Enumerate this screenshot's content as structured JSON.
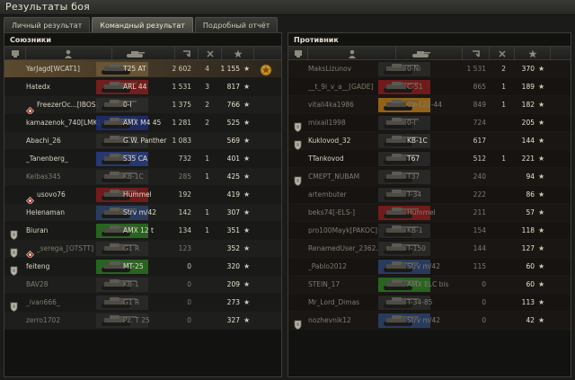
{
  "window": {
    "title": "Результаты боя"
  },
  "tabs": [
    {
      "label": "Личный результат",
      "active": false
    },
    {
      "label": "Командный результат",
      "active": true
    },
    {
      "label": "Подробный отчёт",
      "active": false
    }
  ],
  "allies": {
    "title": "Союзники",
    "rows": [
      {
        "name": "YarJagd[WCAT1]",
        "tank": "T25 AT",
        "dmg": "2 602",
        "kills": "4",
        "xp": "1 155",
        "dead": false,
        "highlight": true,
        "badge": false,
        "mark": false,
        "medal": true,
        "tankColor": "#6b5637"
      },
      {
        "name": "Hatedx",
        "tank": "ARL 44",
        "dmg": "1 531",
        "kills": "3",
        "xp": "817",
        "dead": false,
        "highlight": false,
        "badge": false,
        "mark": false,
        "medal": false,
        "tankColor": "#7b1f1f"
      },
      {
        "name": "FreezerOc...[IBOS]",
        "tank": "0-I",
        "dmg": "1 375",
        "kills": "2",
        "xp": "766",
        "dead": false,
        "highlight": false,
        "badge": false,
        "mark": true,
        "medal": false,
        "tankColor": "#2c2c2c"
      },
      {
        "name": "kamazenok_740[LMK]",
        "tank": "AMX M4 45",
        "dmg": "1 281",
        "kills": "2",
        "xp": "525",
        "dead": false,
        "highlight": false,
        "badge": false,
        "mark": false,
        "medal": false,
        "tankColor": "#1f2d6b"
      },
      {
        "name": "Abachi_26",
        "tank": "G.W. Panther",
        "dmg": "1 083",
        "kills": "",
        "xp": "569",
        "dead": false,
        "highlight": false,
        "badge": false,
        "mark": false,
        "medal": false,
        "tankColor": "#2a2a2a"
      },
      {
        "name": "_Tanenberg_",
        "tank": "S35 CA",
        "dmg": "732",
        "kills": "1",
        "xp": "401",
        "dead": false,
        "highlight": false,
        "badge": false,
        "mark": false,
        "medal": false,
        "tankColor": "#2a3c7a"
      },
      {
        "name": "Kelbas345",
        "tank": "KB-1C",
        "dmg": "285",
        "kills": "1",
        "xp": "425",
        "dead": true,
        "highlight": false,
        "badge": false,
        "mark": false,
        "medal": false,
        "tankColor": "#2a2a2a"
      },
      {
        "name": "usovo76",
        "tank": "Hummel",
        "dmg": "192",
        "kills": "",
        "xp": "419",
        "dead": false,
        "highlight": false,
        "badge": false,
        "mark": true,
        "medal": false,
        "tankColor": "#7a1d1d"
      },
      {
        "name": "Helenaman",
        "tank": "Strv m/42",
        "dmg": "142",
        "kills": "1",
        "xp": "307",
        "dead": false,
        "highlight": false,
        "badge": false,
        "mark": false,
        "medal": false,
        "tankColor": "#2b3f66"
      },
      {
        "name": "Biuran",
        "tank": "AMX 12 t",
        "dmg": "134",
        "kills": "1",
        "xp": "351",
        "dead": false,
        "highlight": false,
        "badge": true,
        "mark": false,
        "medal": false,
        "tankColor": "#2b6b22"
      },
      {
        "name": "_serega_[OTSTT]",
        "tank": "G1 R",
        "dmg": "123",
        "kills": "",
        "xp": "352",
        "dead": true,
        "highlight": false,
        "badge": true,
        "mark": true,
        "medal": false,
        "tankColor": "#2a2a2a"
      },
      {
        "name": "feiteng",
        "tank": "MT-25",
        "dmg": "0",
        "kills": "",
        "xp": "320",
        "dead": false,
        "highlight": false,
        "badge": true,
        "mark": false,
        "medal": false,
        "tankColor": "#2b6b22"
      },
      {
        "name": "BAV28",
        "tank": "KB-1",
        "dmg": "0",
        "kills": "",
        "xp": "209",
        "dead": true,
        "highlight": false,
        "badge": false,
        "mark": false,
        "medal": false,
        "tankColor": "#2a2a2a"
      },
      {
        "name": "_ivan666_",
        "tank": "G1 R",
        "dmg": "0",
        "kills": "",
        "xp": "273",
        "dead": true,
        "highlight": false,
        "badge": true,
        "mark": false,
        "medal": false,
        "tankColor": "#2a2a2a"
      },
      {
        "name": "zerro1702",
        "tank": "Pz. T 25",
        "dmg": "0",
        "kills": "",
        "xp": "327",
        "dead": true,
        "highlight": false,
        "badge": false,
        "mark": false,
        "medal": false,
        "tankColor": "#2a2a2a"
      }
    ]
  },
  "enemies": {
    "title": "Противник",
    "rows": [
      {
        "name": "MaksLizunov",
        "tank": "0-Ni",
        "dmg": "1 531",
        "kills": "2",
        "xp": "370",
        "dead": true,
        "badge": false,
        "tankColor": "#2a2a2a"
      },
      {
        "name": "__t_9i_v_a__[GADE]",
        "tank": "C-51",
        "dmg": "865",
        "kills": "1",
        "xp": "189",
        "dead": true,
        "badge": false,
        "tankColor": "#7a1d1d"
      },
      {
        "name": "vitali4ka1986",
        "tank": "СУ-122-44",
        "dmg": "849",
        "kills": "1",
        "xp": "182",
        "dead": true,
        "badge": false,
        "tankColor": "#a06a1c"
      },
      {
        "name": "mixail1998",
        "tank": "0-I",
        "dmg": "724",
        "kills": "",
        "xp": "205",
        "dead": true,
        "badge": true,
        "tankColor": "#2a2a2a"
      },
      {
        "name": "Kuklovod_32",
        "tank": "KB-1C",
        "dmg": "617",
        "kills": "",
        "xp": "144",
        "dead": false,
        "badge": true,
        "tankColor": "#2a2a2a"
      },
      {
        "name": "TTankovod",
        "tank": "T67",
        "dmg": "512",
        "kills": "1",
        "xp": "221",
        "dead": false,
        "badge": false,
        "tankColor": "#2a2a2a"
      },
      {
        "name": "CMEPT_NUBAM",
        "tank": "T37",
        "dmg": "240",
        "kills": "",
        "xp": "94",
        "dead": true,
        "badge": true,
        "tankColor": "#2a2a2a"
      },
      {
        "name": "artembuter",
        "tank": "T-34",
        "dmg": "222",
        "kills": "",
        "xp": "86",
        "dead": true,
        "badge": false,
        "tankColor": "#2a2a2a"
      },
      {
        "name": "beks74[-ELS-]",
        "tank": "Hummel",
        "dmg": "211",
        "kills": "",
        "xp": "57",
        "dead": true,
        "badge": false,
        "tankColor": "#7a1d1d"
      },
      {
        "name": "pro100Mayk[PAKOC]",
        "tank": "KB-1",
        "dmg": "154",
        "kills": "",
        "xp": "118",
        "dead": true,
        "badge": false,
        "tankColor": "#2a2a2a"
      },
      {
        "name": "RenamedUser_2362...",
        "tank": "T-150",
        "dmg": "144",
        "kills": "",
        "xp": "127",
        "dead": true,
        "badge": false,
        "tankColor": "#2a2a2a"
      },
      {
        "name": "_Pablo2012",
        "tank": "Strv m/42",
        "dmg": "115",
        "kills": "",
        "xp": "60",
        "dead": true,
        "badge": false,
        "tankColor": "#2b3f66"
      },
      {
        "name": "STEIN_17",
        "tank": "AMX ELC bis",
        "dmg": "0",
        "kills": "",
        "xp": "60",
        "dead": true,
        "badge": false,
        "tankColor": "#2b6b22"
      },
      {
        "name": "Mr_Lord_Dimas",
        "tank": "T-34-85",
        "dmg": "0",
        "kills": "",
        "xp": "113",
        "dead": true,
        "badge": false,
        "tankColor": "#2a2a2a"
      },
      {
        "name": "nozhevnik12",
        "tank": "Strv m/42",
        "dmg": "0",
        "kills": "",
        "xp": "42",
        "dead": true,
        "badge": true,
        "tankColor": "#2b3f66"
      }
    ]
  },
  "icons": {
    "platoon": "platoon-icon",
    "player": "player-icon",
    "tank": "tank-icon",
    "damage": "damage-icon",
    "kills": "kills-icon",
    "xp": "xp-star-icon",
    "star": "★"
  }
}
